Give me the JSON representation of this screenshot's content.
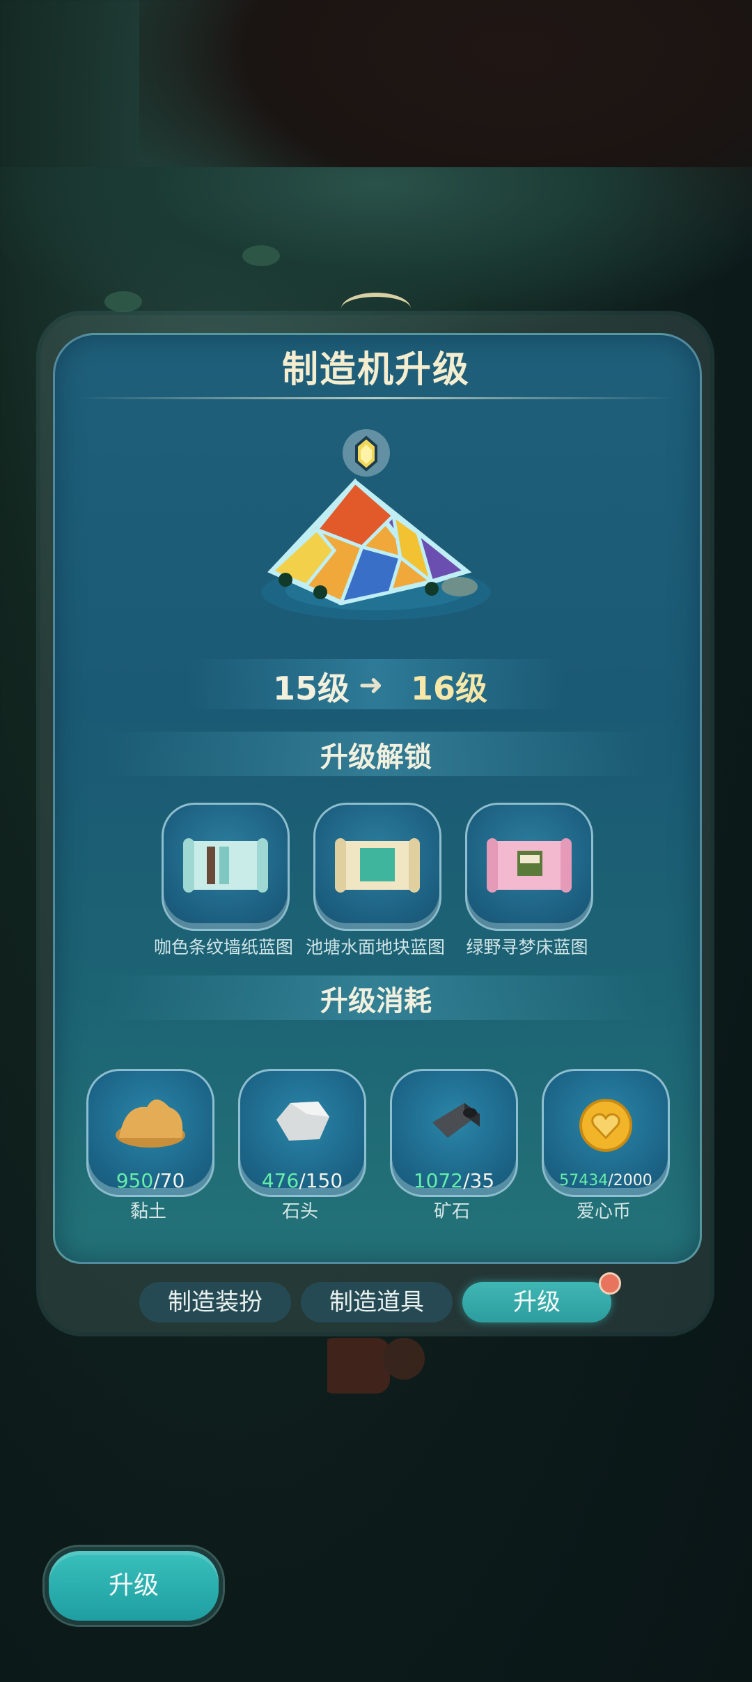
{
  "dialog": {
    "title": "制造机升级",
    "level_from": "15级",
    "level_arrow": "➜",
    "level_to": "16级",
    "unlock_title": "升级解锁",
    "cost_title": "升级消耗"
  },
  "unlocks": [
    {
      "label": "咖色条纹墙纸蓝图",
      "icon": "wallpaper-blueprint-icon"
    },
    {
      "label": "池塘水面地块蓝图",
      "icon": "pond-tile-blueprint-icon"
    },
    {
      "label": "绿野寻梦床蓝图",
      "icon": "bed-blueprint-icon"
    }
  ],
  "costs": [
    {
      "have": "950",
      "sep": "/",
      "need": "70",
      "label": "黏土",
      "icon": "clay-icon"
    },
    {
      "have": "476",
      "sep": "/",
      "need": "150",
      "label": "石头",
      "icon": "stone-icon"
    },
    {
      "have": "1072",
      "sep": "/",
      "need": "35",
      "label": "矿石",
      "icon": "ore-icon"
    },
    {
      "have": "57434",
      "sep": "/",
      "need": "2000",
      "label": "爱心币",
      "icon": "heart-coin-icon"
    }
  ],
  "tabs": [
    {
      "label": "制造装扮",
      "active": false
    },
    {
      "label": "制造道具",
      "active": false
    },
    {
      "label": "升级",
      "active": true
    }
  ],
  "upgrade_button": "升级",
  "colors": {
    "accent": "#3fb7b4",
    "have_amount": "#66eea9",
    "panel": "#1f5f7a",
    "badge": "#e8745e"
  }
}
